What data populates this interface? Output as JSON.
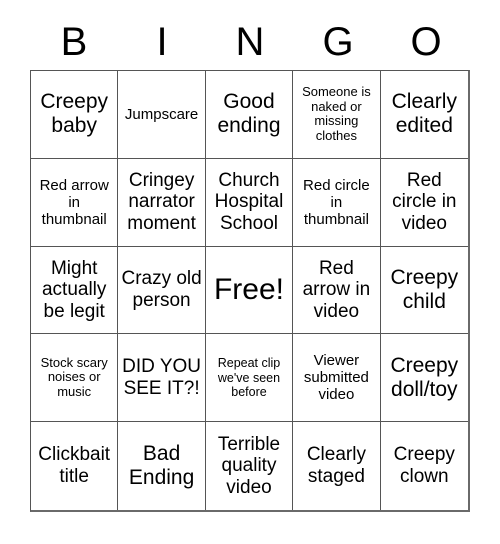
{
  "card": {
    "header_letters": [
      "B",
      "I",
      "N",
      "G",
      "O"
    ],
    "rows": [
      [
        {
          "text": "Creepy baby",
          "size": "lg"
        },
        {
          "text": "Jumpscare",
          "size": "sm"
        },
        {
          "text": "Good ending",
          "size": "lg"
        },
        {
          "text": "Someone is naked or missing clothes",
          "size": "xs"
        },
        {
          "text": "Clearly edited",
          "size": "lg"
        }
      ],
      [
        {
          "text": "Red arrow in thumbnail",
          "size": "sm"
        },
        {
          "text": "Cringey narrator moment",
          "size": "md"
        },
        {
          "text": "Church Hospital School",
          "size": "md"
        },
        {
          "text": "Red circle in thumbnail",
          "size": "sm"
        },
        {
          "text": "Red circle in video",
          "size": "md"
        }
      ],
      [
        {
          "text": "Might actually be legit",
          "size": "md"
        },
        {
          "text": "Crazy old person",
          "size": "md"
        },
        {
          "text": "Free!",
          "size": "xl"
        },
        {
          "text": "Red arrow in video",
          "size": "md"
        },
        {
          "text": "Creepy child",
          "size": "lg"
        }
      ],
      [
        {
          "text": "Stock scary noises or music",
          "size": "xs"
        },
        {
          "text": "DID YOU SEE IT?!",
          "size": "md"
        },
        {
          "text": "Repeat clip we've seen before",
          "size": "xxs"
        },
        {
          "text": "Viewer submitted video",
          "size": "sm"
        },
        {
          "text": "Creepy doll/toy",
          "size": "lg"
        }
      ],
      [
        {
          "text": "Clickbait title",
          "size": "md"
        },
        {
          "text": "Bad Ending",
          "size": "lg"
        },
        {
          "text": "Terrible quality video",
          "size": "md"
        },
        {
          "text": "Clearly staged",
          "size": "md"
        },
        {
          "text": "Creepy clown",
          "size": "md"
        }
      ]
    ]
  }
}
